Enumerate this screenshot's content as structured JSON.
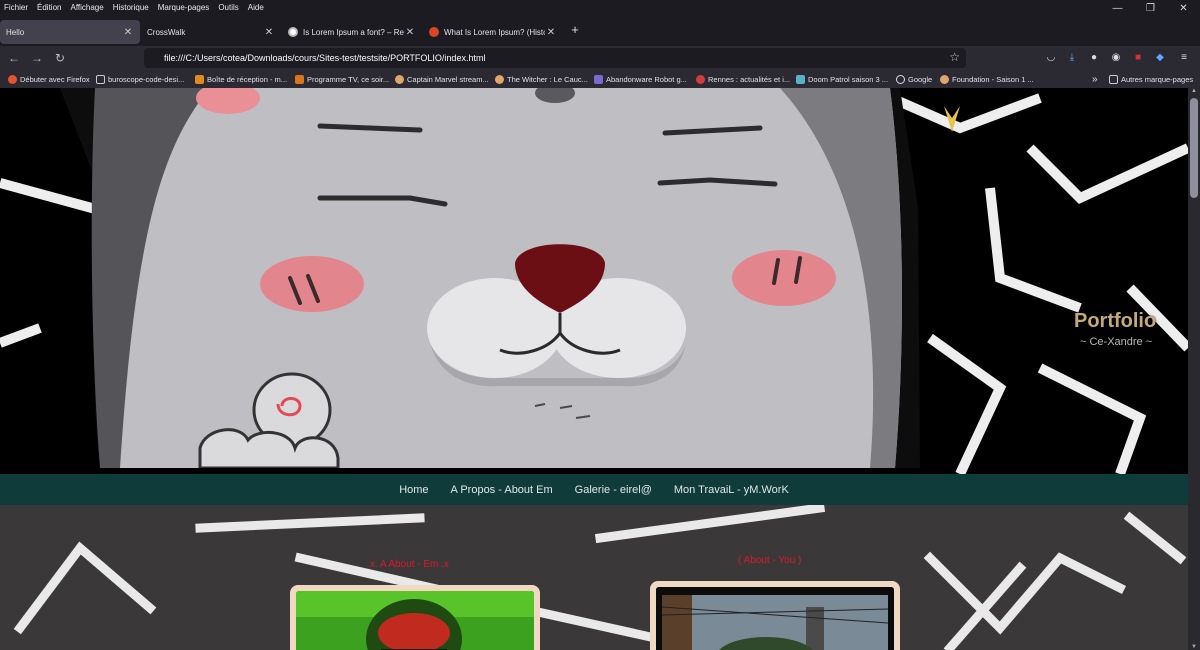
{
  "menubar": {
    "items": [
      "Fichier",
      "Édition",
      "Affichage",
      "Historique",
      "Marque-pages",
      "Outils",
      "Aide"
    ]
  },
  "window_controls": {
    "minimize": "—",
    "restore": "❐",
    "close": "✕"
  },
  "tabs": [
    {
      "title": "Hello",
      "close": "✕",
      "active": true
    },
    {
      "title": "CrossWalk",
      "close": "✕",
      "active": false
    },
    {
      "title": "Is Lorem Ipsum a font? – Recher",
      "close": "✕",
      "active": false
    },
    {
      "title": "What Is Lorem Ipsum? (History,",
      "close": "✕",
      "active": false
    }
  ],
  "new_tab_label": "+",
  "urlbar": {
    "value": "file:///C:/Users/cotea/Downloads/cours/Sites-test/testsite/PORTFOLIO/index.html"
  },
  "bookmarks": {
    "items": [
      "Débuter avec Firefox",
      "buroscope-code-desi...",
      "Boîte de réception - m...",
      "Programme TV, ce soir...",
      "Captain Marvel stream...",
      "The Witcher : Le Cauc...",
      "Abandonware Robot g...",
      "Rennes : actualités et i...",
      "Doom Patrol saison 3 ...",
      "Google",
      "Foundation - Saison 1 ..."
    ],
    "overflow": "»",
    "other": "Autres marque-pages"
  },
  "hero": {
    "title": "Portfolio",
    "subtitle": "~ Ce-Xandre ~"
  },
  "site_nav": {
    "links": [
      "Home",
      "A Propos - About Em",
      "Galerie - eirel@",
      "Mon TravaiL - yM.WorK"
    ]
  },
  "sections": {
    "about_me_title": "x. A  About - Em .x",
    "about_you_title": "( About - You  )"
  },
  "colors": {
    "accent_red": "#e0162b",
    "nav_bg": "#0f3b3a",
    "card_frame": "#f0d8c2",
    "hero_title": "#c4a97a"
  }
}
